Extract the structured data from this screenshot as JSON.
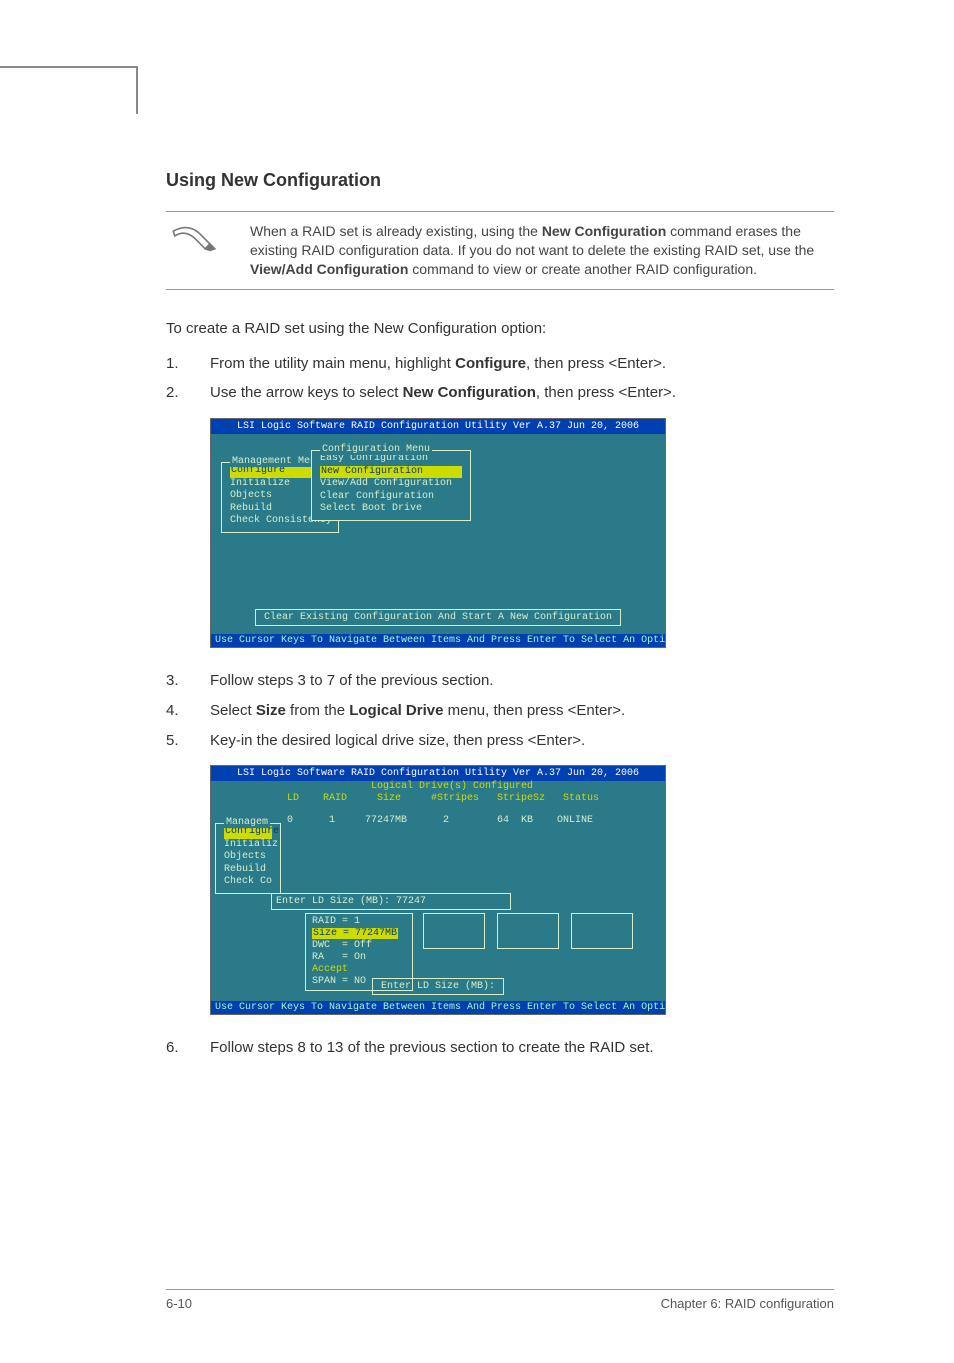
{
  "heading": "Using New Configuration",
  "note": {
    "parts": [
      "When a RAID set is already existing, using the ",
      "New Configuration",
      " command erases the existing RAID configuration data. If you do not want to delete the existing RAID set, use the ",
      "View/Add Configuration",
      " command to view or create another RAID configuration."
    ]
  },
  "intro": "To create a RAID set using the New Configuration option:",
  "steps": {
    "s1a": "From the utility main menu, highlight ",
    "s1b": "Configure",
    "s1c": ", then press <Enter>.",
    "s2a": "Use the arrow keys to select ",
    "s2b": "New Configuration",
    "s2c": ", then press <Enter>.",
    "s3": "Follow steps 3 to 7 of the previous section.",
    "s4a": "Select ",
    "s4b": "Size",
    "s4c": " from the ",
    "s4d": "Logical Drive",
    "s4e": " menu, then press <Enter>.",
    "s5": "Key-in the desired logical drive size, then press <Enter>.",
    "s6": "Follow steps 8 to 13 of the previous section to create the RAID set."
  },
  "bios1": {
    "title": "LSI Logic Software RAID Configuration Utility Ver A.37 Jun 20, 2006",
    "mgmt_title": "Management Menu",
    "mgmt_items": [
      "Configure",
      "Initialize",
      "Objects",
      "Rebuild",
      "Check Consistency"
    ],
    "cfg_title": "Configuration Menu",
    "cfg_items": [
      "Easy Configuration",
      "New Configuration",
      "View/Add Configuration",
      "Clear Configuration",
      "Select Boot Drive"
    ],
    "hint": "Clear Existing Configuration And Start A New Configuration",
    "footer": "Use Cursor Keys To Navigate Between Items And Press Enter To Select An Option"
  },
  "bios2": {
    "title": "LSI Logic Software RAID Configuration Utility Ver A.37 Jun 20, 2006",
    "subtitle": "Logical Drive(s) Configured",
    "head": " LD    RAID     Size     #Stripes   StripeSz   Status",
    "row": " 0      1     77247MB      2        64  KB    ONLINE",
    "mgmt_title": "Managem",
    "mgmt_items": [
      "Configure",
      "Initializ",
      "Objects",
      "Rebuild",
      "Check Co"
    ],
    "input_label": "Enter LD Size (MB): 77247",
    "opts": [
      "RAID = 1",
      "Size = 77247MB",
      "DWC  = Off",
      "RA   = On",
      "Accept",
      "SPAN = NO"
    ],
    "hint": "Enter LD Size (MB):",
    "footer": "Use Cursor Keys To Navigate Between Items And Press Enter To Select An Option"
  },
  "footer": {
    "left": "6-10",
    "right": "Chapter 6: RAID configuration"
  }
}
